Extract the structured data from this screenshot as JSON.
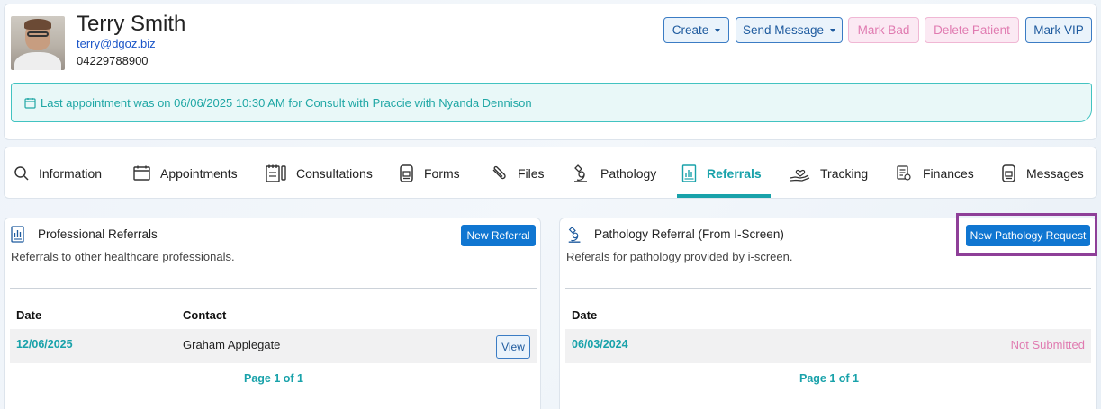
{
  "patient": {
    "name": "Terry Smith",
    "email": "terry@dgoz.biz",
    "phone": "04229788900"
  },
  "header_actions": {
    "create": "Create",
    "send_message": "Send Message",
    "mark_bad": "Mark Bad",
    "delete_patient": "Delete Patient",
    "mark_vip": "Mark VIP"
  },
  "appointment_banner": "Last appointment was on 06/06/2025 10:30 AM for Consult with Praccie with Nyanda Dennison",
  "tabs": [
    {
      "label": "Information",
      "icon": "search-icon"
    },
    {
      "label": "Appointments",
      "icon": "calendar-icon"
    },
    {
      "label": "Consultations",
      "icon": "notebook-icon"
    },
    {
      "label": "Forms",
      "icon": "form-icon"
    },
    {
      "label": "Files",
      "icon": "paperclip-icon"
    },
    {
      "label": "Pathology",
      "icon": "microscope-icon"
    },
    {
      "label": "Referrals",
      "icon": "chart-document-icon"
    },
    {
      "label": "Tracking",
      "icon": "hand-heart-icon"
    },
    {
      "label": "Finances",
      "icon": "receipt-icon"
    },
    {
      "label": "Messages",
      "icon": "message-icon"
    }
  ],
  "active_tab": "Referrals",
  "professional_referrals": {
    "title": "Professional Referrals",
    "description": "Referrals to other healthcare professionals.",
    "new_button": "New Referral",
    "columns": [
      "Date",
      "Contact"
    ],
    "rows": [
      {
        "date": "12/06/2025",
        "contact": "Graham Applegate",
        "action": "View"
      }
    ],
    "pager": "Page 1 of 1"
  },
  "pathology_referrals": {
    "title": "Pathology Referral (From I-Screen)",
    "description": "Referals for pathology provided by i-screen.",
    "new_button": "New Pathology Request",
    "columns": [
      "Date"
    ],
    "rows": [
      {
        "date": "06/03/2024",
        "status": "Not Submitted"
      }
    ],
    "pager": "Page 1 of 1"
  },
  "colors": {
    "accent_teal": "#19a2aa",
    "primary_blue": "#1076d1",
    "danger_pink": "#e07ab0",
    "highlight_purple": "#8e3f98"
  }
}
